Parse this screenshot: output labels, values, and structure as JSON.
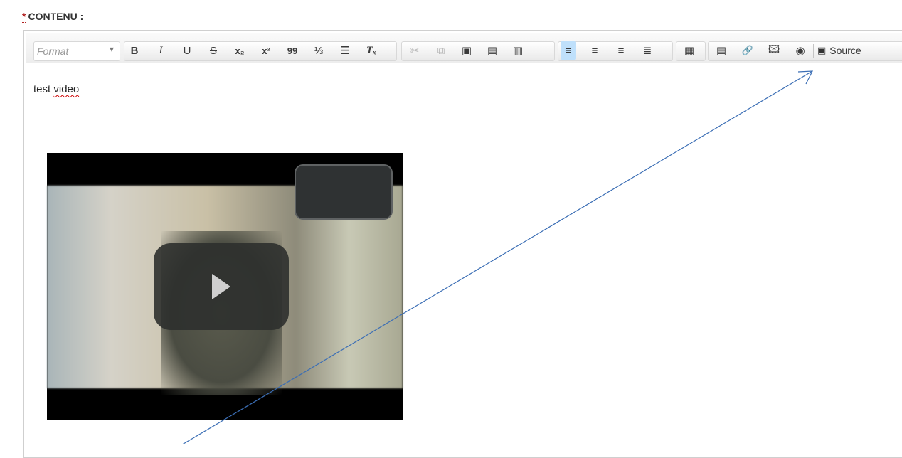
{
  "field": {
    "required_mark": "*",
    "label": "CONTENU :"
  },
  "toolbar": {
    "format_label": "Format",
    "format_arrow": "▾",
    "buttons": {
      "bold": "B",
      "italic": "I",
      "underline": "U",
      "strike": "S",
      "subscript": "x₂",
      "superscript": "x²",
      "quote": "99",
      "ol": "⅓",
      "ul": "☰",
      "clear": "Tₓ",
      "cut": "✂",
      "copy": "⧉",
      "paste": "▣",
      "paste_text": "▤",
      "paste_word": "▥",
      "align_left": "≡",
      "align_center": "≡",
      "align_right": "≡",
      "justify": "≣",
      "table": "▦",
      "doc": "▤",
      "link": "🔗",
      "image": "🖾",
      "media": "◉",
      "source_icon": "▣"
    },
    "source_label": "Source"
  },
  "content": {
    "text_prefix": "test ",
    "text_misspelled": "video"
  },
  "colors": {
    "arrow": "#3b6eb5",
    "active_button": "#bfe0fb"
  }
}
